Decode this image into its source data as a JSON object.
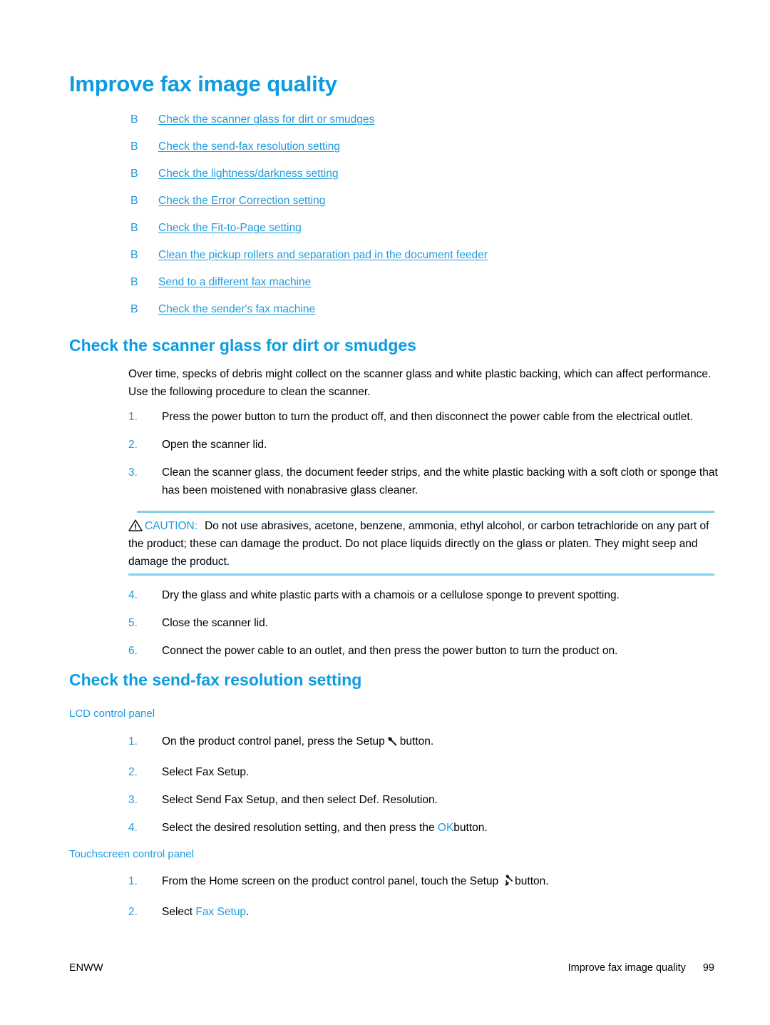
{
  "document": {
    "title": "Improve fax image quality"
  },
  "toc": {
    "bullet": "B",
    "links": [
      {
        "label": "Check the scanner glass for dirt or smudges"
      },
      {
        "label": "Check the send-fax resolution setting"
      },
      {
        "label": "Check the lightness/darkness setting"
      },
      {
        "label": "Check the Error Correction setting"
      },
      {
        "label": "Check the Fit-to-Page setting"
      },
      {
        "label": "Clean the pickup rollers and separation pad in the document feeder"
      },
      {
        "label": "Send to a different fax machine"
      },
      {
        "label": "Check the sender's fax machine"
      }
    ]
  },
  "section_scanner_glass": {
    "heading": "Check the scanner glass for dirt or smudges",
    "intro": "Over time, specks of debris might collect on the scanner glass and white plastic backing, which can affect performance. Use the following procedure to clean the scanner.",
    "steps_before_note": [
      {
        "num": "1.",
        "text": "Press the power button to turn the product off, and then disconnect the power cable from the electrical outlet."
      },
      {
        "num": "2.",
        "text": "Open the scanner lid."
      },
      {
        "num": "3.",
        "text": "Clean the scanner glass, the document feeder strips, and the white plastic backing with a soft cloth or sponge that has been moistened with nonabrasive glass cleaner."
      }
    ],
    "caution": {
      "icon": "warning-triangle-icon",
      "label": "CAUTION:",
      "text": "Do not use abrasives, acetone, benzene, ammonia, ethyl alcohol, or carbon tetrachloride on any part of the product; these can damage the product. Do not place liquids directly on the glass or platen. They might seep and damage the product."
    },
    "steps_after_note": [
      {
        "num": "4.",
        "text": "Dry the glass and white plastic parts with a chamois or a cellulose sponge to prevent spotting."
      },
      {
        "num": "5.",
        "text": "Close the scanner lid."
      },
      {
        "num": "6.",
        "text": "Connect the power cable to an outlet, and then press the power button to turn the product on."
      }
    ]
  },
  "section_send_fax_resolution": {
    "heading": "Check the send-fax resolution setting",
    "lcd": {
      "subheading": "LCD control panel",
      "steps": [
        {
          "num": "1.",
          "text_before": "On the product control panel, press the Setup",
          "icon": "wrench-icon",
          "text_after": "button."
        },
        {
          "num": "2.",
          "text": "Select Fax Setup."
        },
        {
          "num": "3.",
          "text": "Select Send Fax Setup, and then select Def. Resolution."
        },
        {
          "num": "4.",
          "text_before": "Select the desired resolution setting, and then press the",
          "highlight": "OK",
          "text_after": "button."
        }
      ]
    },
    "touchscreen": {
      "subheading": "Touchscreen control panel",
      "steps": [
        {
          "num": "1.",
          "text_before": "From the Home screen on the product control panel, touch the Setup",
          "icon": "wrench-gear-icon",
          "text_after": "button."
        },
        {
          "num": "2.",
          "text_before": "Select",
          "highlight": "Fax Setup",
          "text_after": "."
        }
      ]
    }
  },
  "footer": {
    "left": "ENWW",
    "running_title": "Improve fax image quality",
    "page_number": "99"
  },
  "colors": {
    "accent_blue": "#0c9ce0",
    "link_blue": "#1f9bdc",
    "rule_blue": "#7fd3ee",
    "body_text": "#000000",
    "background": "#ffffff"
  }
}
